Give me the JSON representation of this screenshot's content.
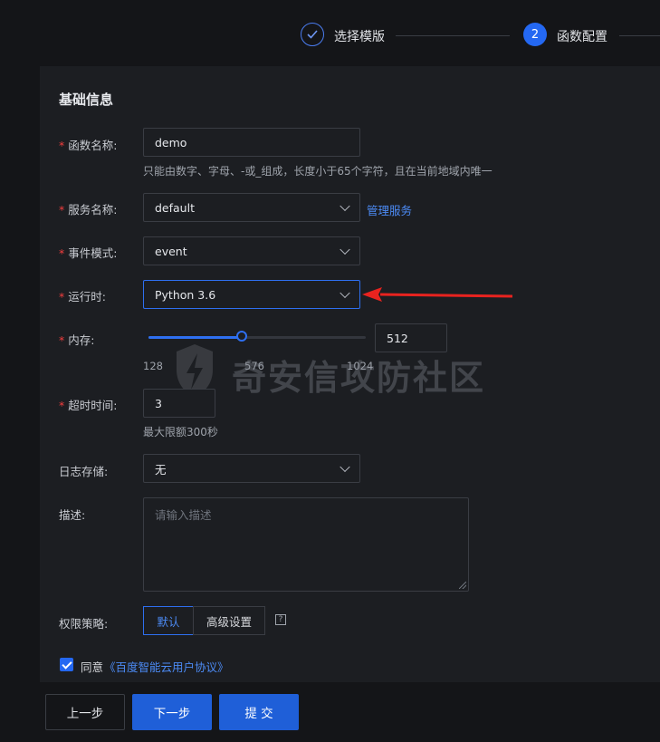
{
  "steps": [
    {
      "label": "选择模版",
      "state": "done",
      "icon": "check-icon"
    },
    {
      "label": "函数配置",
      "state": "active",
      "number": "2"
    }
  ],
  "section": {
    "title": "基础信息"
  },
  "form": {
    "function_name": {
      "label": "函数名称:",
      "value": "demo",
      "hint": "只能由数字、字母、-或_组成，长度小于65个字符，且在当前地域内唯一"
    },
    "service_name": {
      "label": "服务名称:",
      "value": "default",
      "link": "管理服务"
    },
    "event_mode": {
      "label": "事件模式:",
      "value": "event"
    },
    "runtime": {
      "label": "运行时:",
      "value": "Python 3.6"
    },
    "memory": {
      "label": "内存:",
      "value": "512",
      "min_label": "128",
      "mid_label": "576",
      "max_label": "1024",
      "min": 128,
      "max": 1024,
      "current": 512
    },
    "timeout": {
      "label": "超时时间:",
      "value": "3",
      "hint": "最大限额300秒"
    },
    "log_storage": {
      "label": "日志存储:",
      "value": "无"
    },
    "description": {
      "label": "描述:",
      "placeholder": "请输入描述"
    },
    "permission": {
      "label": "权限策略:",
      "options": [
        "默认",
        "高级设置"
      ],
      "selected": "默认",
      "help": "?"
    },
    "agree": {
      "prefix": "同意",
      "link": "《百度智能云用户协议》",
      "checked": true
    }
  },
  "buttons": {
    "prev": "上一步",
    "next": "下一步",
    "submit": "提 交"
  },
  "watermark": {
    "text": "奇安信攻防社区"
  },
  "colors": {
    "accent": "#2468f2",
    "required": "#f33e3e",
    "arrow": "#e8231f",
    "background": "#141518",
    "panel": "#1c1e22"
  }
}
